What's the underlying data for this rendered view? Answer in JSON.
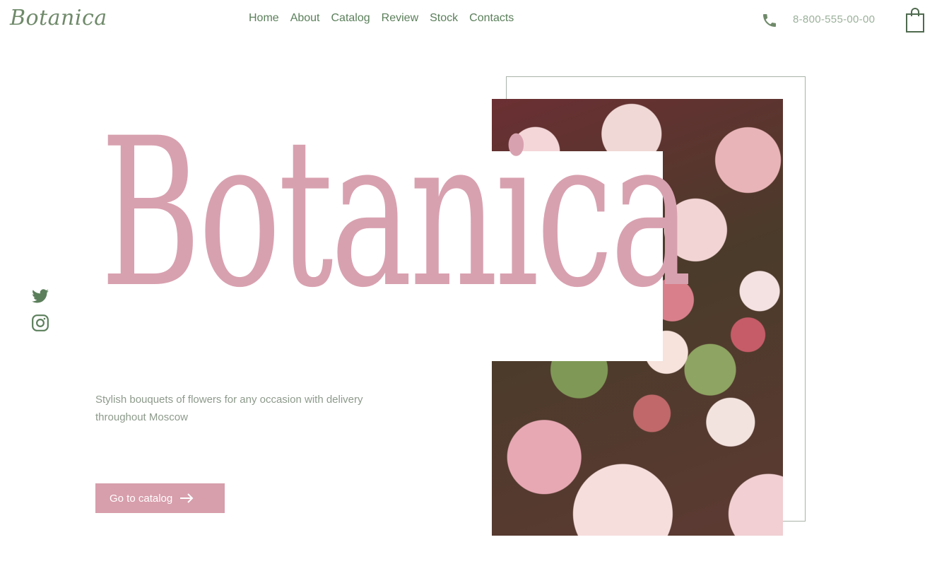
{
  "header": {
    "logo": "Botanica",
    "nav": [
      "Home",
      "About",
      "Catalog",
      "Review",
      "Stock",
      "Contacts"
    ],
    "phone": "8-800-555-00-00"
  },
  "hero": {
    "title": "Botanica",
    "tagline": "Stylish bouquets of flowers for any occasion with delivery throughout Moscow",
    "cta_label": "Go to catalog"
  },
  "icons": {
    "phone": "phone-icon",
    "cart": "shopping-bag-icon",
    "twitter": "twitter-icon",
    "instagram": "instagram-icon",
    "arrow": "arrow-right-icon"
  },
  "colors": {
    "accent_pink": "#d79eab",
    "title_pink": "#d8a1b0",
    "green": "#5b7f5b",
    "frame": "#a9b3a8"
  }
}
